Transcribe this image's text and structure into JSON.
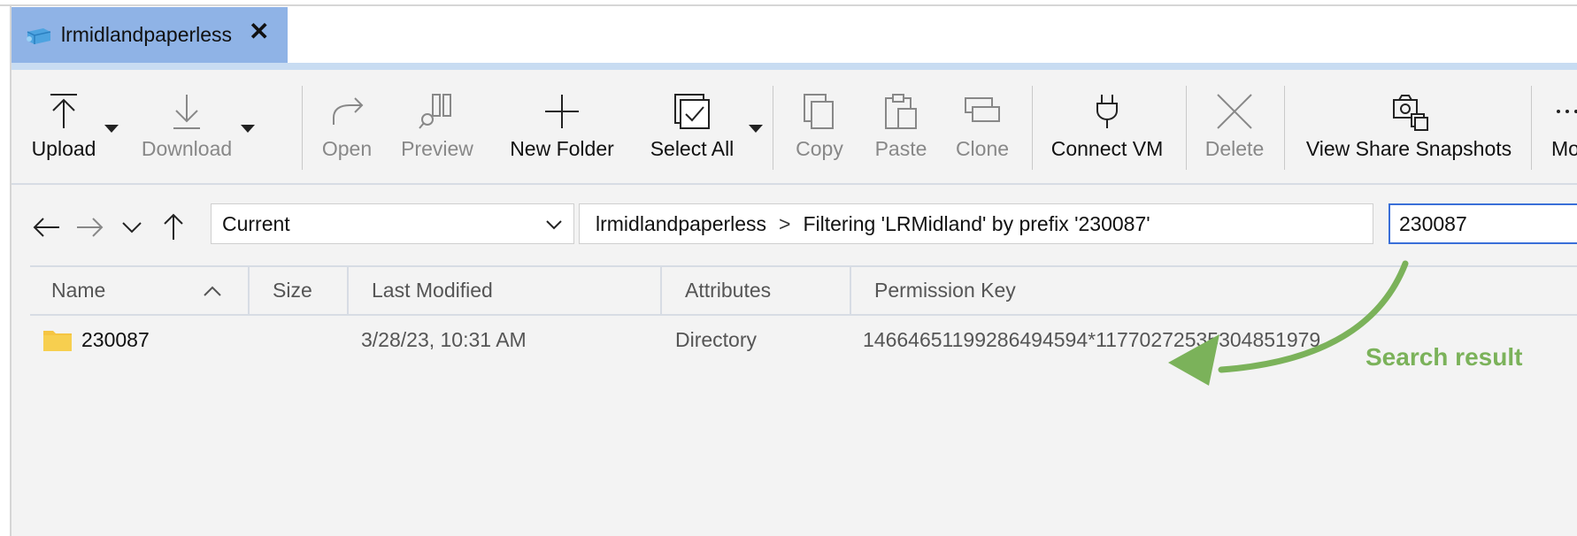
{
  "tab": {
    "title": "lrmidlandpaperless",
    "close_glyph": "✕",
    "icon": "storage-share-icon"
  },
  "toolbar": {
    "buttons": [
      {
        "label": "Upload",
        "icon": "upload-icon",
        "enabled": true,
        "has_dropdown": true
      },
      {
        "label": "Download",
        "icon": "download-icon",
        "enabled": false,
        "has_dropdown": true
      },
      {
        "label": "Open",
        "icon": "open-icon",
        "enabled": false
      },
      {
        "label": "Preview",
        "icon": "preview-icon",
        "enabled": false
      },
      {
        "label": "New Folder",
        "icon": "new-folder-icon",
        "enabled": true
      },
      {
        "label": "Select All",
        "icon": "select-all-icon",
        "enabled": true,
        "has_dropdown": true
      },
      {
        "label": "Copy",
        "icon": "copy-icon",
        "enabled": false
      },
      {
        "label": "Paste",
        "icon": "paste-icon",
        "enabled": false
      },
      {
        "label": "Clone",
        "icon": "clone-icon",
        "enabled": false
      },
      {
        "label": "Connect VM",
        "icon": "plug-icon",
        "enabled": true
      },
      {
        "label": "Delete",
        "icon": "delete-icon",
        "enabled": false
      },
      {
        "label": "View Share Snapshots",
        "icon": "snapshots-icon",
        "enabled": true
      },
      {
        "label": "Mo",
        "icon": "more-icon",
        "enabled": true
      }
    ]
  },
  "navigation": {
    "location_select": "Current",
    "breadcrumb": {
      "root": "lrmidlandpaperless",
      "separator": ">",
      "current": "Filtering 'LRMidland' by prefix '230087'"
    },
    "search_value": "230087"
  },
  "table": {
    "columns": [
      "Name",
      "Size",
      "Last Modified",
      "Attributes",
      "Permission Key"
    ],
    "rows": [
      {
        "name": "230087",
        "size": "",
        "last_modified": "3/28/23, 10:31 AM",
        "attributes": "Directory",
        "permission_key": "14664651199286494594*11770272535304851979",
        "icon": "folder-icon"
      }
    ]
  },
  "annotation": {
    "label": "Search result",
    "color": "#7bb25a"
  },
  "colors": {
    "tab_bg": "#8fb3e6",
    "accent": "#3a6fd8",
    "folder": "#f5c542"
  }
}
